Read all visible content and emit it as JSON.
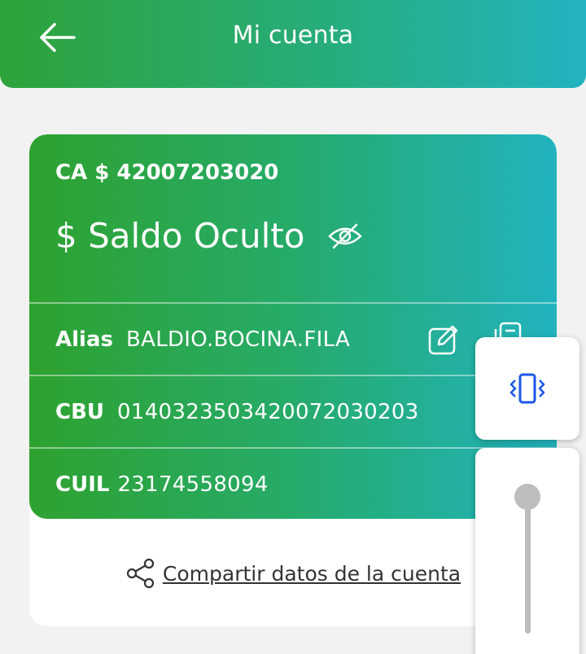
{
  "header": {
    "title": "Mi cuenta",
    "back_icon": "arrow-left-icon"
  },
  "account": {
    "number": "CA $ 42007203020",
    "balance": "$ Saldo Oculto",
    "visibility_icon": "eye-off-icon",
    "rows": [
      {
        "label": "Alias",
        "value": "BALDIO.BOCINA.FILA"
      },
      {
        "label": "CBU",
        "value": "0140323503420072030203"
      },
      {
        "label": "CUIL",
        "value": "23174558094"
      }
    ],
    "edit_icon": "edit-icon",
    "copy_icon": "copy-icon"
  },
  "share": {
    "label": "Compartir datos de la cuenta",
    "icon": "share-icon"
  },
  "system_overlay": {
    "vibrate_icon": "vibrate-icon",
    "volume_level": 1.0
  },
  "colors": {
    "gradient_start": "#2ea33a",
    "gradient_end": "#22b3c0",
    "vibrate_icon": "#1a56e8"
  }
}
